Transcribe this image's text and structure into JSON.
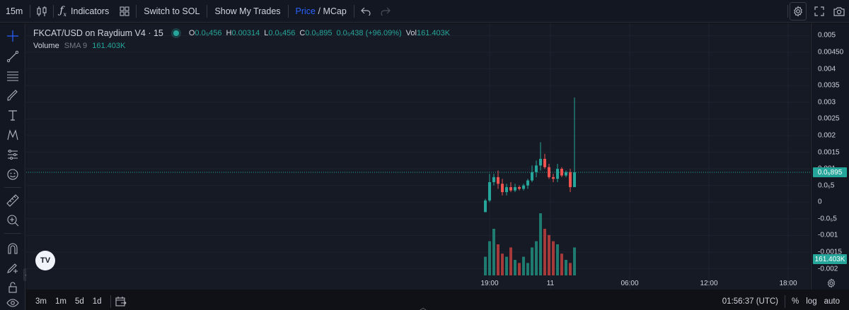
{
  "toolbar": {
    "interval": "15m",
    "indicators_label": "Indicators",
    "switch_label": "Switch to SOL",
    "trades_label": "Show My Trades",
    "price_label": "Price",
    "slash": " / ",
    "mcap_label": "MCap"
  },
  "legend": {
    "symbol": "FKCAT/USD on Raydium V4 · 15",
    "o_key": "O",
    "o_val": "0.0₅456",
    "h_key": "H",
    "h_val": "0.00314",
    "l_key": "L",
    "l_val": "0.0₅456",
    "c_key": "C",
    "c_val": "0.0₅895",
    "change": "0.0₅438 (+96.09%)",
    "vol_key": "Vol",
    "vol_val": "161.403K"
  },
  "volume_legend": {
    "name": "Volume",
    "ma": "SMA 9",
    "value": "161.403K"
  },
  "price_axis": {
    "ticks": [
      "0.005",
      "0.00450",
      "0.004",
      "0.0035",
      "0.003",
      "0.0025",
      "0.002",
      "0.0015",
      "0.001",
      "0.0₅5",
      "0",
      "-0.0₅5",
      "-0.001",
      "-0.0015",
      "-0.002"
    ],
    "last_price_label": "0.0₅895",
    "last_volume_label": "161.403K"
  },
  "time_axis": {
    "ticks": [
      "19:00",
      "11",
      "06:00",
      "12:00",
      "18:00"
    ]
  },
  "bottom": {
    "ranges": [
      "3m",
      "1m",
      "5d",
      "1d"
    ],
    "clock": "01:56:37 (UTC)",
    "percent": "%",
    "log": "log",
    "auto": "auto"
  },
  "colors": {
    "up": "#26a69a",
    "down": "#ef5350",
    "accent": "#2962ff"
  },
  "chart_data": {
    "type": "candlestick",
    "candles": [
      {
        "o": -0.0003,
        "h": 0.0001,
        "l": -0.0003,
        "c": 5e-05
      },
      {
        "o": 5e-05,
        "h": 0.00085,
        "l": 0.0,
        "c": 0.0006
      },
      {
        "o": 0.0006,
        "h": 0.00085,
        "l": 0.0005,
        "c": 0.00075
      },
      {
        "o": 0.00075,
        "h": 0.00095,
        "l": 0.0004,
        "c": 0.00055
      },
      {
        "o": 0.00055,
        "h": 0.0007,
        "l": 0.0002,
        "c": 0.0003
      },
      {
        "o": 0.0003,
        "h": 0.00055,
        "l": 0.0002,
        "c": 0.00045
      },
      {
        "o": 0.00045,
        "h": 0.0006,
        "l": 0.0003,
        "c": 0.00035
      },
      {
        "o": 0.00035,
        "h": 0.00055,
        "l": 0.0003,
        "c": 0.00045
      },
      {
        "o": 0.00045,
        "h": 0.0005,
        "l": 0.00035,
        "c": 0.0004
      },
      {
        "o": 0.0004,
        "h": 0.00055,
        "l": 0.00035,
        "c": 0.0005
      },
      {
        "o": 0.0005,
        "h": 0.0007,
        "l": 0.0004,
        "c": 0.00065
      },
      {
        "o": 0.00065,
        "h": 0.0011,
        "l": 0.0006,
        "c": 0.0009
      },
      {
        "o": 0.0009,
        "h": 0.00125,
        "l": 0.00075,
        "c": 0.0011
      },
      {
        "o": 0.0011,
        "h": 0.0018,
        "l": 0.00095,
        "c": 0.0013
      },
      {
        "o": 0.0013,
        "h": 0.00145,
        "l": 0.001,
        "c": 0.00105
      },
      {
        "o": 0.00105,
        "h": 0.00115,
        "l": 0.0007,
        "c": 0.00075
      },
      {
        "o": 0.00075,
        "h": 0.00085,
        "l": 0.0006,
        "c": 0.0007
      },
      {
        "o": 0.0007,
        "h": 0.00115,
        "l": 0.0006,
        "c": 0.001
      },
      {
        "o": 0.001,
        "h": 0.00105,
        "l": 0.00075,
        "c": 0.0008
      },
      {
        "o": 0.0008,
        "h": 0.00095,
        "l": 0.00075,
        "c": 0.0009
      },
      {
        "o": 0.0009,
        "h": 0.001,
        "l": 0.0003,
        "c": 0.00045
      },
      {
        "o": 0.00045,
        "h": 0.00314,
        "l": 0.00045,
        "c": 0.000895
      }
    ],
    "volumes": [
      0.3,
      0.55,
      0.75,
      0.5,
      0.35,
      0.3,
      0.45,
      0.25,
      0.2,
      0.3,
      0.2,
      0.45,
      0.55,
      1.0,
      0.75,
      0.65,
      0.55,
      0.5,
      0.35,
      0.25,
      0.2,
      0.45
    ],
    "ylim": [
      -0.0022,
      0.0052
    ]
  }
}
